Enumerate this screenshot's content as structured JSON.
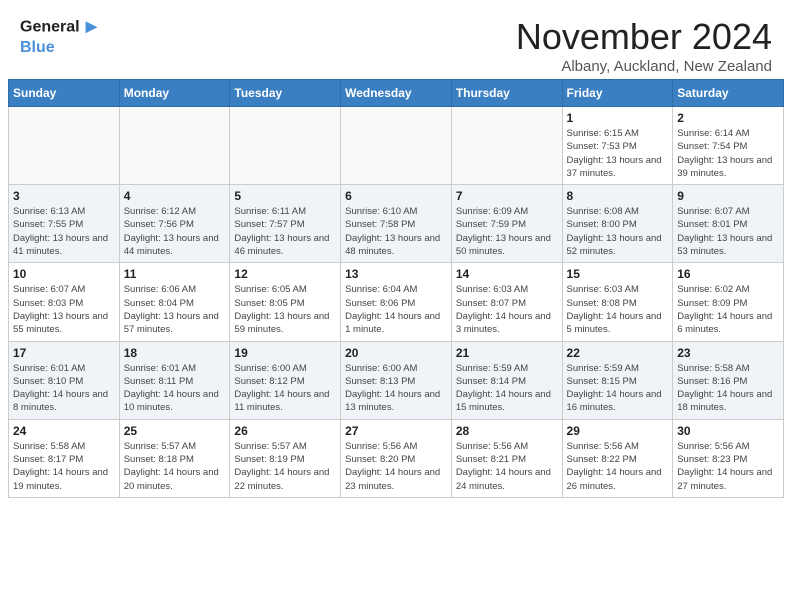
{
  "header": {
    "logo_line1": "General",
    "logo_line2": "Blue",
    "month": "November 2024",
    "location": "Albany, Auckland, New Zealand"
  },
  "weekdays": [
    "Sunday",
    "Monday",
    "Tuesday",
    "Wednesday",
    "Thursday",
    "Friday",
    "Saturday"
  ],
  "weeks": [
    [
      {
        "day": "",
        "info": "",
        "empty": true
      },
      {
        "day": "",
        "info": "",
        "empty": true
      },
      {
        "day": "",
        "info": "",
        "empty": true
      },
      {
        "day": "",
        "info": "",
        "empty": true
      },
      {
        "day": "",
        "info": "",
        "empty": true
      },
      {
        "day": "1",
        "info": "Sunrise: 6:15 AM\nSunset: 7:53 PM\nDaylight: 13 hours and 37 minutes.",
        "empty": false
      },
      {
        "day": "2",
        "info": "Sunrise: 6:14 AM\nSunset: 7:54 PM\nDaylight: 13 hours and 39 minutes.",
        "empty": false
      }
    ],
    [
      {
        "day": "3",
        "info": "Sunrise: 6:13 AM\nSunset: 7:55 PM\nDaylight: 13 hours and 41 minutes.",
        "empty": false
      },
      {
        "day": "4",
        "info": "Sunrise: 6:12 AM\nSunset: 7:56 PM\nDaylight: 13 hours and 44 minutes.",
        "empty": false
      },
      {
        "day": "5",
        "info": "Sunrise: 6:11 AM\nSunset: 7:57 PM\nDaylight: 13 hours and 46 minutes.",
        "empty": false
      },
      {
        "day": "6",
        "info": "Sunrise: 6:10 AM\nSunset: 7:58 PM\nDaylight: 13 hours and 48 minutes.",
        "empty": false
      },
      {
        "day": "7",
        "info": "Sunrise: 6:09 AM\nSunset: 7:59 PM\nDaylight: 13 hours and 50 minutes.",
        "empty": false
      },
      {
        "day": "8",
        "info": "Sunrise: 6:08 AM\nSunset: 8:00 PM\nDaylight: 13 hours and 52 minutes.",
        "empty": false
      },
      {
        "day": "9",
        "info": "Sunrise: 6:07 AM\nSunset: 8:01 PM\nDaylight: 13 hours and 53 minutes.",
        "empty": false
      }
    ],
    [
      {
        "day": "10",
        "info": "Sunrise: 6:07 AM\nSunset: 8:03 PM\nDaylight: 13 hours and 55 minutes.",
        "empty": false
      },
      {
        "day": "11",
        "info": "Sunrise: 6:06 AM\nSunset: 8:04 PM\nDaylight: 13 hours and 57 minutes.",
        "empty": false
      },
      {
        "day": "12",
        "info": "Sunrise: 6:05 AM\nSunset: 8:05 PM\nDaylight: 13 hours and 59 minutes.",
        "empty": false
      },
      {
        "day": "13",
        "info": "Sunrise: 6:04 AM\nSunset: 8:06 PM\nDaylight: 14 hours and 1 minute.",
        "empty": false
      },
      {
        "day": "14",
        "info": "Sunrise: 6:03 AM\nSunset: 8:07 PM\nDaylight: 14 hours and 3 minutes.",
        "empty": false
      },
      {
        "day": "15",
        "info": "Sunrise: 6:03 AM\nSunset: 8:08 PM\nDaylight: 14 hours and 5 minutes.",
        "empty": false
      },
      {
        "day": "16",
        "info": "Sunrise: 6:02 AM\nSunset: 8:09 PM\nDaylight: 14 hours and 6 minutes.",
        "empty": false
      }
    ],
    [
      {
        "day": "17",
        "info": "Sunrise: 6:01 AM\nSunset: 8:10 PM\nDaylight: 14 hours and 8 minutes.",
        "empty": false
      },
      {
        "day": "18",
        "info": "Sunrise: 6:01 AM\nSunset: 8:11 PM\nDaylight: 14 hours and 10 minutes.",
        "empty": false
      },
      {
        "day": "19",
        "info": "Sunrise: 6:00 AM\nSunset: 8:12 PM\nDaylight: 14 hours and 11 minutes.",
        "empty": false
      },
      {
        "day": "20",
        "info": "Sunrise: 6:00 AM\nSunset: 8:13 PM\nDaylight: 14 hours and 13 minutes.",
        "empty": false
      },
      {
        "day": "21",
        "info": "Sunrise: 5:59 AM\nSunset: 8:14 PM\nDaylight: 14 hours and 15 minutes.",
        "empty": false
      },
      {
        "day": "22",
        "info": "Sunrise: 5:59 AM\nSunset: 8:15 PM\nDaylight: 14 hours and 16 minutes.",
        "empty": false
      },
      {
        "day": "23",
        "info": "Sunrise: 5:58 AM\nSunset: 8:16 PM\nDaylight: 14 hours and 18 minutes.",
        "empty": false
      }
    ],
    [
      {
        "day": "24",
        "info": "Sunrise: 5:58 AM\nSunset: 8:17 PM\nDaylight: 14 hours and 19 minutes.",
        "empty": false
      },
      {
        "day": "25",
        "info": "Sunrise: 5:57 AM\nSunset: 8:18 PM\nDaylight: 14 hours and 20 minutes.",
        "empty": false
      },
      {
        "day": "26",
        "info": "Sunrise: 5:57 AM\nSunset: 8:19 PM\nDaylight: 14 hours and 22 minutes.",
        "empty": false
      },
      {
        "day": "27",
        "info": "Sunrise: 5:56 AM\nSunset: 8:20 PM\nDaylight: 14 hours and 23 minutes.",
        "empty": false
      },
      {
        "day": "28",
        "info": "Sunrise: 5:56 AM\nSunset: 8:21 PM\nDaylight: 14 hours and 24 minutes.",
        "empty": false
      },
      {
        "day": "29",
        "info": "Sunrise: 5:56 AM\nSunset: 8:22 PM\nDaylight: 14 hours and 26 minutes.",
        "empty": false
      },
      {
        "day": "30",
        "info": "Sunrise: 5:56 AM\nSunset: 8:23 PM\nDaylight: 14 hours and 27 minutes.",
        "empty": false
      }
    ]
  ]
}
